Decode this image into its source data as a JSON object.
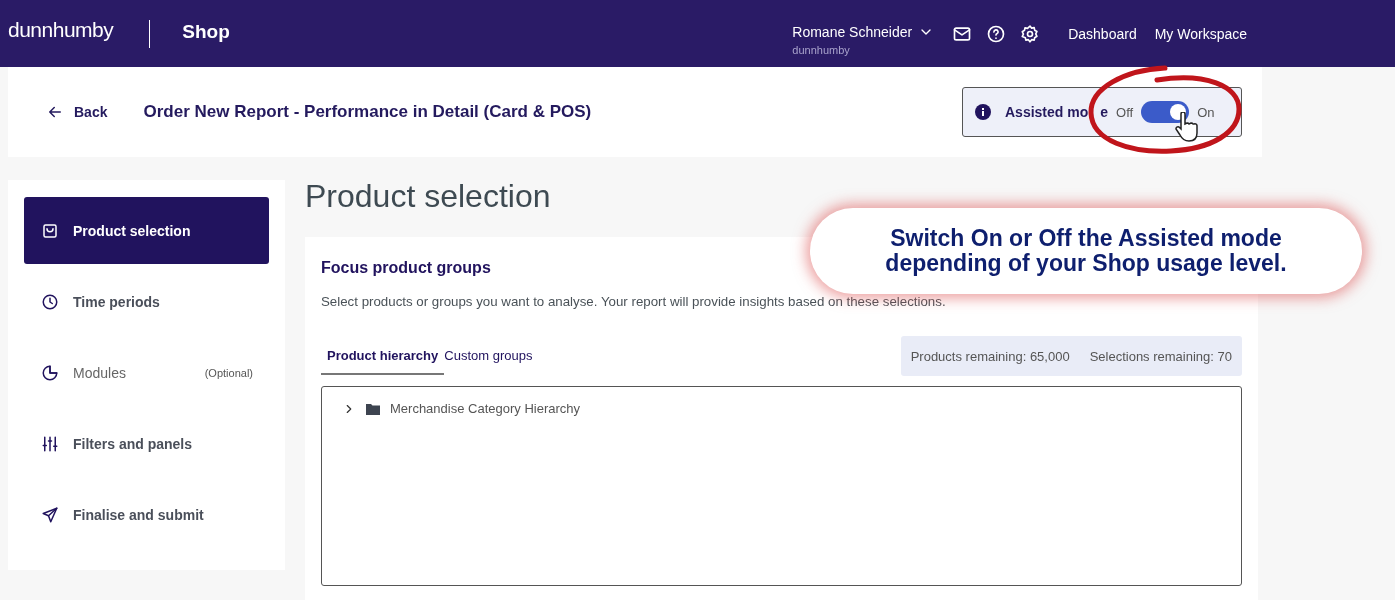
{
  "top_bar": {
    "logo": "dunnhumby",
    "app_name": "Shop",
    "user": {
      "name": "Romane Schneider",
      "organisation": "dunnhumby"
    },
    "nav_links": [
      "Dashboard",
      "My Workspace"
    ]
  },
  "header": {
    "back_label": "Back",
    "title": "Order New Report - Performance in Detail (Card & POS)",
    "assisted_mode": {
      "label": "Assisted mo",
      "label_tail": "e",
      "off_label": "Off",
      "on_label": "On",
      "on": true
    }
  },
  "sidebar": {
    "items": [
      {
        "label": "Product selection",
        "selected": true
      },
      {
        "label": "Time periods",
        "selected": false
      },
      {
        "label": "Modules",
        "selected": false,
        "note": "(Optional)",
        "muted": true
      },
      {
        "label": "Filters and panels",
        "selected": false
      },
      {
        "label": "Finalise and submit",
        "selected": false
      }
    ]
  },
  "main": {
    "title": "Product selection",
    "card": {
      "heading": "Focus product groups",
      "description": "Select products or groups you want to analyse. Your report will provide insights based on these selections.",
      "tabs": [
        {
          "label": "Product hierarchy",
          "selected": true
        },
        {
          "label": "Custom groups",
          "selected": false
        }
      ],
      "counters": [
        "Products remaining: 65,000",
        "Selections remaining: 70"
      ],
      "tree": [
        {
          "label": "Merchandise Category Hierarchy",
          "expanded": false
        }
      ]
    }
  },
  "callout": {
    "text": "Switch On or Off the Assisted mode depending of your Shop usage level."
  }
}
